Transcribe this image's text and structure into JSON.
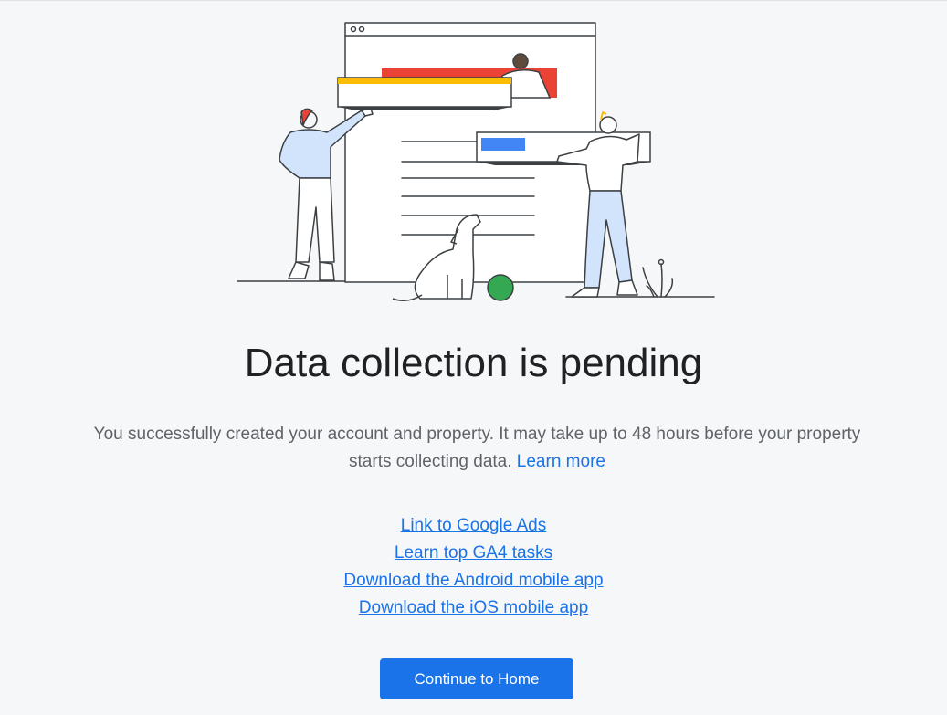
{
  "empty_state": {
    "title": "Data collection is pending",
    "description": "You successfully created your account and property. It may take up to 48 hours before your property starts collecting data.",
    "learn_more": "Learn more"
  },
  "links": [
    {
      "label": "Link to Google Ads"
    },
    {
      "label": "Learn top GA4 tasks"
    },
    {
      "label": "Download the Android mobile app"
    },
    {
      "label": "Download the iOS mobile app"
    }
  ],
  "continue_button": {
    "label": "Continue to Home"
  },
  "colors": {
    "accent": "#1a73e8",
    "red": "#ea4335",
    "yellow": "#fbbc04",
    "green": "#34a853",
    "light_blue": "#d2e3fc"
  }
}
